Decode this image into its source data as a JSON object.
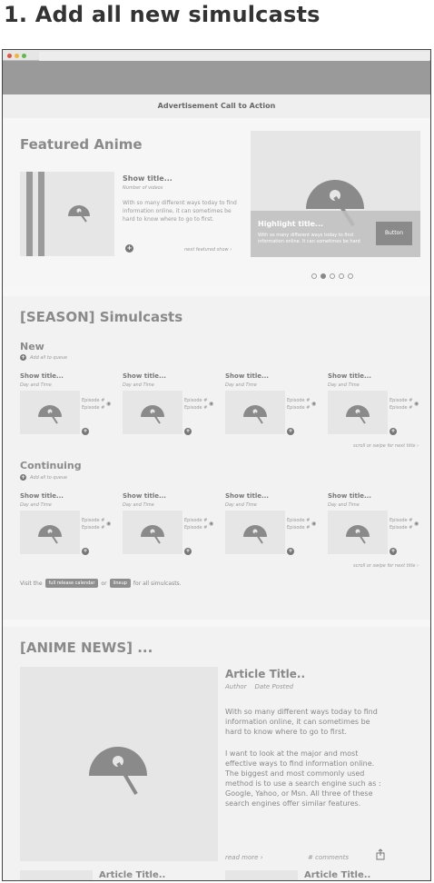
{
  "step_heading": "1. Add all new simulcasts",
  "ad_bar": "Advertisement Call to Action",
  "featured": {
    "title": "Featured Anime",
    "show_title": "Show title...",
    "num_videos": "Number of videos",
    "desc": "With so many different ways today to find information online, it can sometimes be hard to know where to go to first.",
    "next_link": "next featured show ›",
    "highlight_title": "Highlight title...",
    "highlight_desc": "With so many different ways today to find information online. It can sometimes be hard",
    "button": "Button"
  },
  "simulcasts": {
    "title": "[SEASON] Simulcasts",
    "new_label": "New",
    "continuing_label": "Continuing",
    "add_queue": "Add all to queue",
    "show_title": "Show title...",
    "day_time": "Day and Time",
    "episode": "Episode #",
    "scroll_hint": "scroll or swipe for next title ›",
    "visit_prefix": "Visit the",
    "calendar_btn": "full release calendar",
    "or": "or",
    "lineup_btn": "lineup",
    "visit_suffix": "for all simulcasts."
  },
  "news": {
    "title": "[ANIME NEWS] ...",
    "article_title": "Article Title..",
    "author": "Author",
    "date": "Date Posted",
    "para1": "With so many different ways today to find information online, it can sometimes be hard to know where to go to first.",
    "para2": "I want to look at the major and most effective ways to find information online. The biggest and most commonly used method is to use a search engine such as : Google, Yahoo, or Msn. All three of these search engines offer similar features.",
    "read_more": "read more ›",
    "comments": "# comments",
    "bottom_article_title": "Article Title.."
  },
  "colors": {
    "dot_red": "#e2563f",
    "dot_yellow": "#f2b233",
    "dot_green": "#5fba49",
    "header": "#9a9a9a"
  }
}
